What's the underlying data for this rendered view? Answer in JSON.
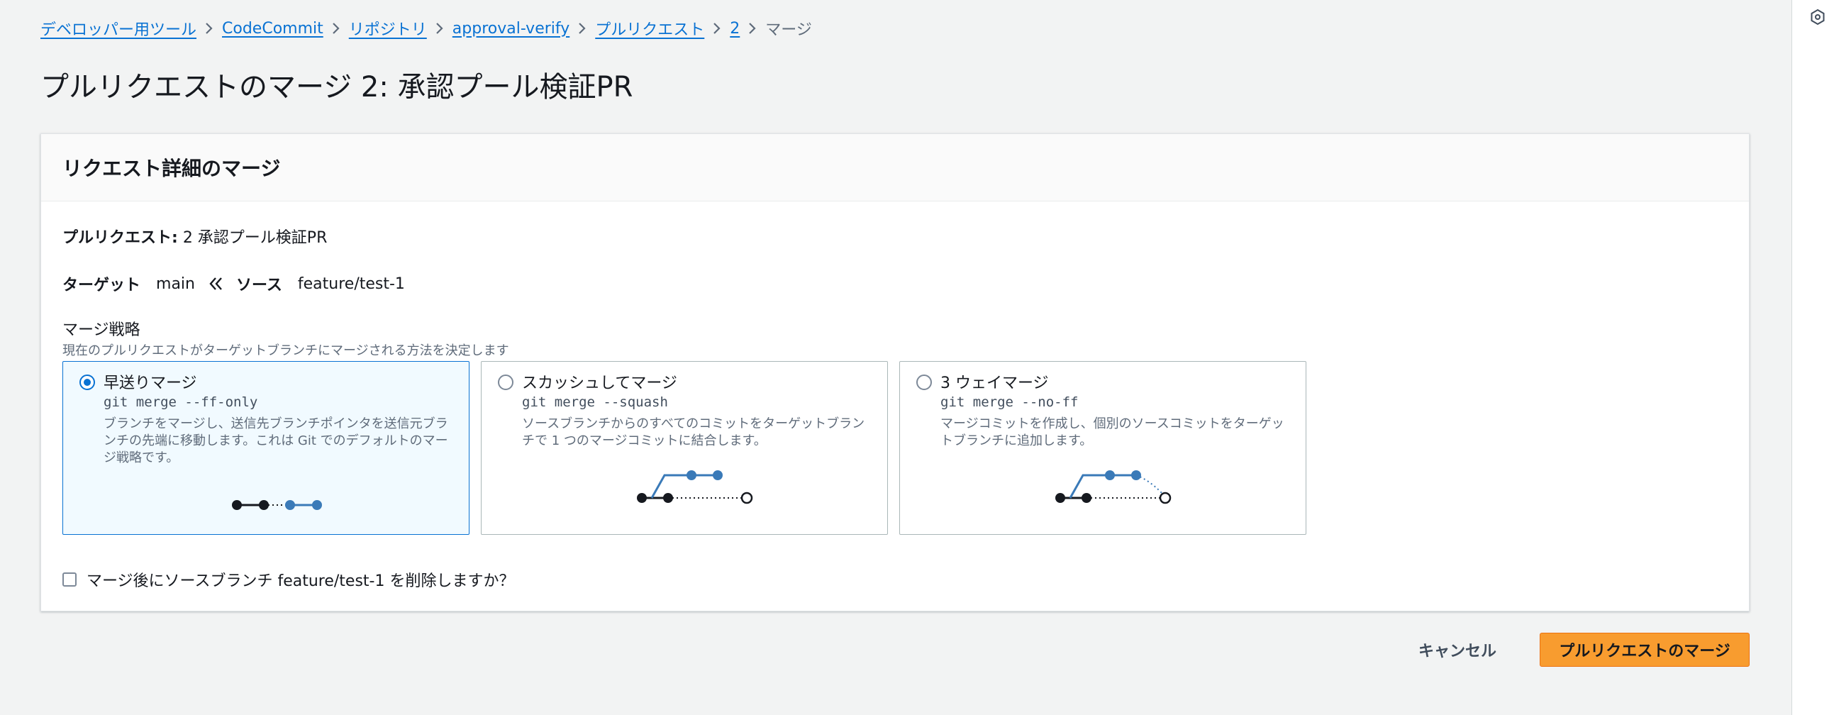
{
  "breadcrumb": {
    "items": [
      "デベロッパー用ツール",
      "CodeCommit",
      "リポジトリ",
      "approval-verify",
      "プルリクエスト",
      "2"
    ],
    "current": "マージ"
  },
  "page": {
    "title": "プルリクエストのマージ 2: 承認プール検証PR"
  },
  "panel": {
    "title": "リクエスト詳細のマージ",
    "pr_label": "プルリクエスト:",
    "pr_value": "2 承認プール検証PR",
    "target_label": "ターゲット",
    "target_value": "main",
    "source_label": "ソース",
    "source_value": "feature/test-1",
    "strategy_label": "マージ戦略",
    "strategy_description": "現在のプルリクエストがターゲットブランチにマージされる方法を決定します"
  },
  "strategies": [
    {
      "title": "早送りマージ",
      "command": "git merge --ff-only",
      "description": "ブランチをマージし、送信先ブランチポインタを送信元ブランチの先端に移動します。これは Git でのデフォルトのマージ戦略です。",
      "selected": true
    },
    {
      "title": "スカッシュしてマージ",
      "command": "git merge --squash",
      "description": "ソースブランチからのすべてのコミットをターゲットブランチで 1 つのマージコミットに結合します。",
      "selected": false
    },
    {
      "title": "3 ウェイマージ",
      "command": "git merge --no-ff",
      "description": "マージコミットを作成し、個別のソースコミットをターゲットブランチに追加します。",
      "selected": false
    }
  ],
  "delete_branch": {
    "label": "マージ後にソースブランチ feature/test-1 を削除しますか？",
    "checked": false
  },
  "actions": {
    "cancel_label": "キャンセル",
    "merge_label": "プルリクエストのマージ"
  },
  "colors": {
    "link": "#0972d3",
    "primary_button": "#f89c2f",
    "selected_tile_bg": "#f1faff",
    "commit_blue": "#3a7ab8"
  }
}
